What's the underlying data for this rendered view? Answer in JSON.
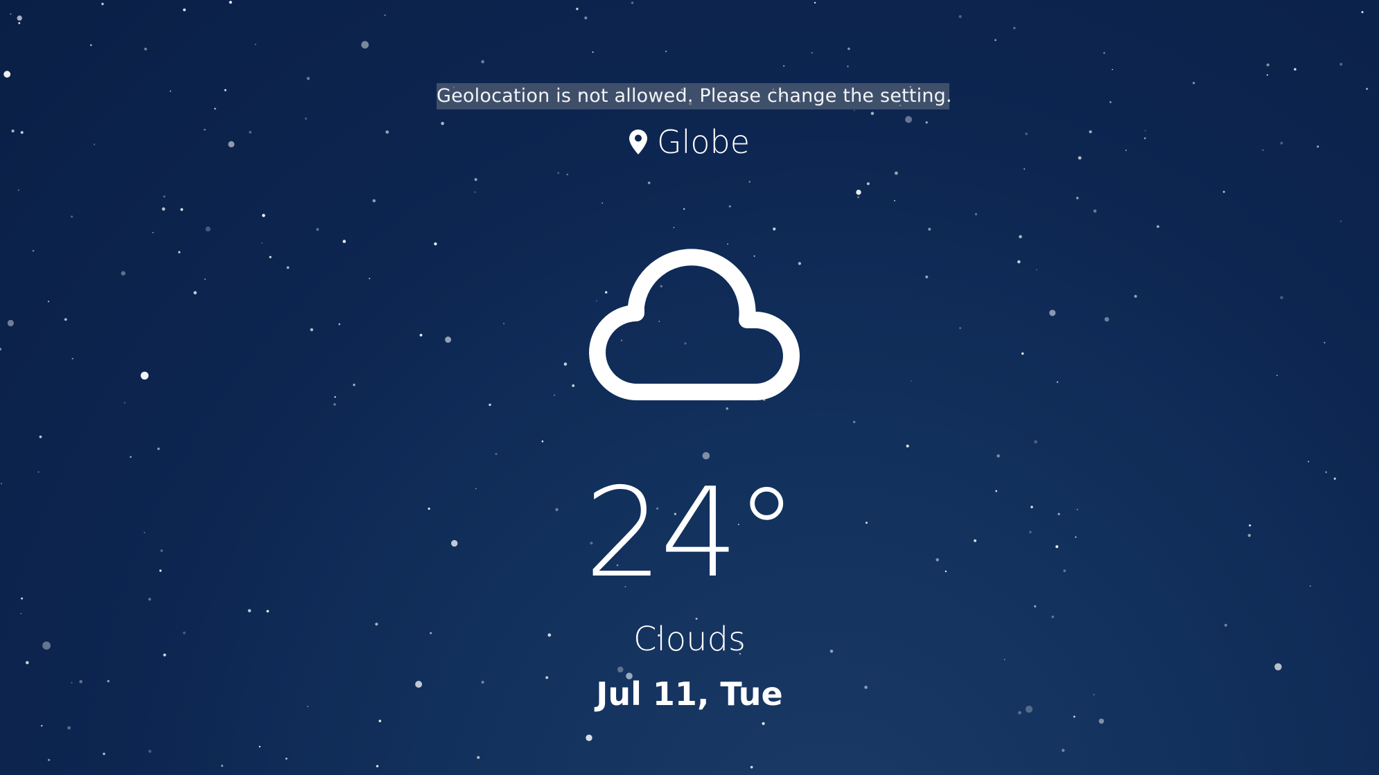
{
  "warning": {
    "text": "Geolocation is not allowed. Please change the setting."
  },
  "location": {
    "name": "Globe",
    "icon": "map-pin-icon"
  },
  "weather": {
    "icon": "cloud-icon",
    "temperature": "24°",
    "description": "Clouds",
    "date": "Jul 11, Tue"
  },
  "colors": {
    "text": "#ffffff",
    "background": "#0d2651",
    "warning_background": "#6b7382"
  }
}
